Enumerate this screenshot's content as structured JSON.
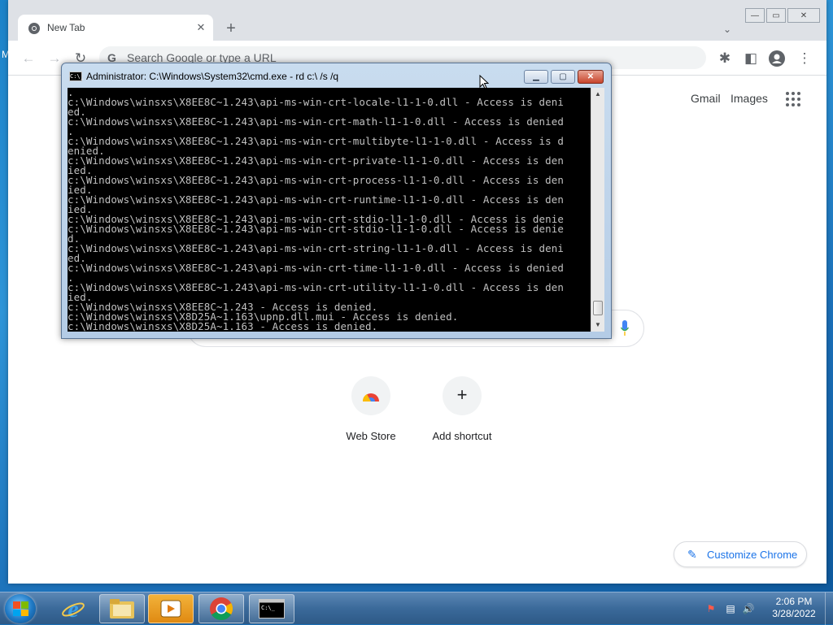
{
  "desktop": {
    "edge_char": "M"
  },
  "chrome": {
    "tab": {
      "title": "New Tab",
      "close_glyph": "✕"
    },
    "new_tab_glyph": "+",
    "tab_search_glyph": "⌄",
    "window_controls": {
      "minimize": "—",
      "maximize": "▭",
      "close": "✕"
    },
    "toolbar": {
      "back_glyph": "←",
      "forward_glyph": "→",
      "reload_glyph": "↻",
      "omnibox_icon": "G",
      "omnibox_placeholder": "Search Google or type a URL",
      "extensions_glyph": "✱",
      "sidepanel_glyph": "◧",
      "menu_glyph": "⋮"
    },
    "ntp": {
      "links": {
        "gmail": "Gmail",
        "images": "Images"
      },
      "shortcuts": [
        {
          "label": "Web Store"
        },
        {
          "label": "Add shortcut",
          "glyph": "+"
        }
      ],
      "customize_label": "Customize Chrome",
      "customize_icon_glyph": "✎"
    }
  },
  "cmd": {
    "icon_text": "C:\\_",
    "title": "Administrator: C:\\Windows\\System32\\cmd.exe - rd  c:\\ /s /q",
    "controls": {
      "minimize": "▁",
      "maximize": "▢",
      "close": "✕"
    },
    "scroll_up": "▲",
    "scroll_down": "▼",
    "lines": [
      ".",
      "c:\\Windows\\winsxs\\X8EE8C~1.243\\api-ms-win-crt-locale-l1-1-0.dll - Access is deni",
      "ed.",
      "c:\\Windows\\winsxs\\X8EE8C~1.243\\api-ms-win-crt-math-l1-1-0.dll - Access is denied",
      ".",
      "c:\\Windows\\winsxs\\X8EE8C~1.243\\api-ms-win-crt-multibyte-l1-1-0.dll - Access is d",
      "enied.",
      "c:\\Windows\\winsxs\\X8EE8C~1.243\\api-ms-win-crt-private-l1-1-0.dll - Access is den",
      "ied.",
      "c:\\Windows\\winsxs\\X8EE8C~1.243\\api-ms-win-crt-process-l1-1-0.dll - Access is den",
      "ied.",
      "c:\\Windows\\winsxs\\X8EE8C~1.243\\api-ms-win-crt-runtime-l1-1-0.dll - Access is den",
      "ied.",
      "c:\\Windows\\winsxs\\X8EE8C~1.243\\api-ms-win-crt-stdio-l1-1-0.dll - Access is denie",
      "c:\\Windows\\winsxs\\X8EE8C~1.243\\api-ms-win-crt-stdio-l1-1-0.dll - Access is denie",
      "d.",
      "c:\\Windows\\winsxs\\X8EE8C~1.243\\api-ms-win-crt-string-l1-1-0.dll - Access is deni",
      "ed.",
      "c:\\Windows\\winsxs\\X8EE8C~1.243\\api-ms-win-crt-time-l1-1-0.dll - Access is denied",
      ".",
      "c:\\Windows\\winsxs\\X8EE8C~1.243\\api-ms-win-crt-utility-l1-1-0.dll - Access is den",
      "ied.",
      "c:\\Windows\\winsxs\\X8EE8C~1.243 - Access is denied.",
      "c:\\Windows\\winsxs\\X8D25A~1.163\\upnp.dll.mui - Access is denied.",
      "c:\\Windows\\winsxs\\X8D25A~1.163 - Access is denied."
    ]
  },
  "taskbar": {
    "items": [
      {
        "name": "internet-explorer",
        "active": false
      },
      {
        "name": "windows-explorer",
        "active": true
      },
      {
        "name": "media-player",
        "active": true
      },
      {
        "name": "chrome",
        "active": true
      },
      {
        "name": "command-prompt",
        "active": true
      }
    ],
    "tray": {
      "action_center_glyph": "⚑",
      "network_glyph": "▤",
      "volume_glyph": "🔊"
    },
    "clock": {
      "time": "2:06 PM",
      "date": "3/28/2022"
    }
  }
}
